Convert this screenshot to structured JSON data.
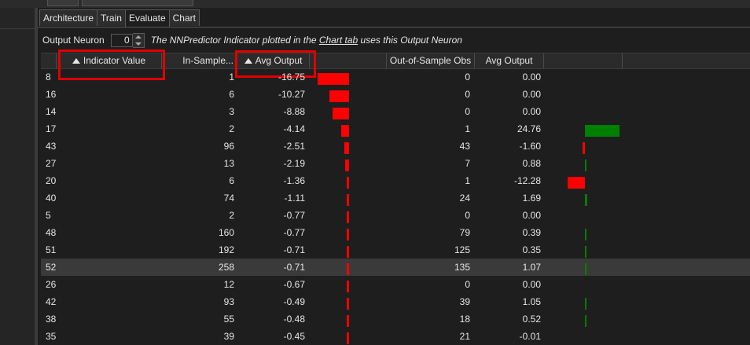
{
  "tabs": [
    "Architecture",
    "Train",
    "Evaluate",
    "Chart"
  ],
  "active_tab": "Evaluate",
  "output_neuron": {
    "label": "Output Neuron",
    "value": "0",
    "note_prefix": "The NNPredictor Indicator plotted in the ",
    "note_link": "Chart tab",
    "note_suffix": " uses this Output Neuron"
  },
  "columns": [
    "Indicator Value",
    "In-Sample...",
    "Avg Output",
    "",
    "Out-of-Sample Obs",
    "Avg Output",
    ""
  ],
  "colors": {
    "negative_bar": "#ff0000",
    "positive_bar": "#008000",
    "highlight_box": "#e00000"
  },
  "rows": [
    {
      "indicator": "8",
      "in_sample": "1",
      "avg_output": "-16.75",
      "oos_obs": "0",
      "oos_avg": "0.00",
      "in_val": -16.75,
      "oos_val": 0
    },
    {
      "indicator": "16",
      "in_sample": "6",
      "avg_output": "-10.27",
      "oos_obs": "0",
      "oos_avg": "0.00",
      "in_val": -10.27,
      "oos_val": 0
    },
    {
      "indicator": "14",
      "in_sample": "3",
      "avg_output": "-8.88",
      "oos_obs": "0",
      "oos_avg": "0.00",
      "in_val": -8.88,
      "oos_val": 0
    },
    {
      "indicator": "17",
      "in_sample": "2",
      "avg_output": "-4.14",
      "oos_obs": "1",
      "oos_avg": "24.76",
      "in_val": -4.14,
      "oos_val": 24.76
    },
    {
      "indicator": "43",
      "in_sample": "96",
      "avg_output": "-2.51",
      "oos_obs": "43",
      "oos_avg": "-1.60",
      "in_val": -2.51,
      "oos_val": -1.6
    },
    {
      "indicator": "27",
      "in_sample": "13",
      "avg_output": "-2.19",
      "oos_obs": "7",
      "oos_avg": "0.88",
      "in_val": -2.19,
      "oos_val": 0.88
    },
    {
      "indicator": "20",
      "in_sample": "6",
      "avg_output": "-1.36",
      "oos_obs": "1",
      "oos_avg": "-12.28",
      "in_val": -1.36,
      "oos_val": -12.28
    },
    {
      "indicator": "40",
      "in_sample": "74",
      "avg_output": "-1.11",
      "oos_obs": "24",
      "oos_avg": "1.69",
      "in_val": -1.11,
      "oos_val": 1.69
    },
    {
      "indicator": "5",
      "in_sample": "2",
      "avg_output": "-0.77",
      "oos_obs": "0",
      "oos_avg": "0.00",
      "in_val": -0.77,
      "oos_val": 0
    },
    {
      "indicator": "48",
      "in_sample": "160",
      "avg_output": "-0.77",
      "oos_obs": "79",
      "oos_avg": "0.39",
      "in_val": -0.77,
      "oos_val": 0.39
    },
    {
      "indicator": "51",
      "in_sample": "192",
      "avg_output": "-0.71",
      "oos_obs": "125",
      "oos_avg": "0.35",
      "in_val": -0.71,
      "oos_val": 0.35
    },
    {
      "indicator": "52",
      "in_sample": "258",
      "avg_output": "-0.71",
      "oos_obs": "135",
      "oos_avg": "1.07",
      "in_val": -0.71,
      "oos_val": 1.07,
      "selected": true
    },
    {
      "indicator": "26",
      "in_sample": "12",
      "avg_output": "-0.67",
      "oos_obs": "0",
      "oos_avg": "0.00",
      "in_val": -0.67,
      "oos_val": 0
    },
    {
      "indicator": "42",
      "in_sample": "93",
      "avg_output": "-0.49",
      "oos_obs": "39",
      "oos_avg": "1.05",
      "in_val": -0.49,
      "oos_val": 1.05
    },
    {
      "indicator": "38",
      "in_sample": "55",
      "avg_output": "-0.48",
      "oos_obs": "18",
      "oos_avg": "0.52",
      "in_val": -0.48,
      "oos_val": 0.52
    },
    {
      "indicator": "35",
      "in_sample": "39",
      "avg_output": "-0.45",
      "oos_obs": "21",
      "oos_avg": "-0.01",
      "in_val": -0.45,
      "oos_val": -0.01
    }
  ]
}
